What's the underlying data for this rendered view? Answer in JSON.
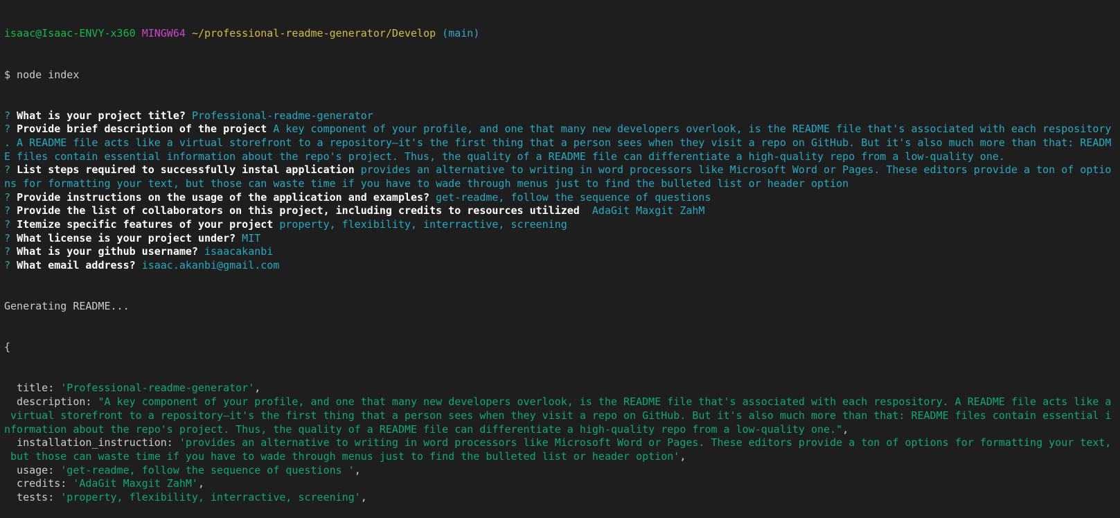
{
  "prompt": {
    "user": "isaac@Isaac-ENVY-x360",
    "shell": "MINGW64",
    "path": "~/professional-readme-generator/Develop",
    "branch": "(main)",
    "command": "$ node index"
  },
  "qa": [
    {
      "q": "What is your project title?",
      "a": "Professional-readme-generator",
      "wrap": []
    },
    {
      "q": "Provide brief description of the project",
      "a": "A key component of your profile, and one that many new developers overlook, is the README file that's associated with each respository",
      "wrap": [
        ". A README file acts like a virtual storefront to a repository—it's the first thing that a person sees when they visit a repo on GitHub. But it's also much more than that: READM",
        "E files contain essential information about the repo's project. Thus, the quality of a README file can differentiate a high-quality repo from a low-quality one."
      ]
    },
    {
      "q": "List steps required to successfully instal application",
      "a": "provides an alternative to writing in word processors like Microsoft Word or Pages. These editors provide a ton of optio",
      "wrap": [
        "ns for formatting your text, but those can waste time if you have to wade through menus just to find the bulleted list or header option"
      ]
    },
    {
      "q": "Provide instructions on the usage of the application and examples?",
      "a": "get-readme, follow the sequence of questions",
      "wrap": []
    },
    {
      "q": "Provide the list of collaborators on this project, including credits to resources utilized",
      "a": " AdaGit Maxgit ZahM",
      "wrap": []
    },
    {
      "q": "Itemize specific features of your project",
      "a": "property, flexibility, interractive, screening",
      "wrap": []
    },
    {
      "q": "What license is your project under?",
      "a": "MIT",
      "wrap": []
    },
    {
      "q": "What is your github username?",
      "a": "isaacakanbi",
      "wrap": []
    },
    {
      "q": "What email address?",
      "a": "isaac.akanbi@gmail.com",
      "wrap": []
    }
  ],
  "generating": "Generating README...",
  "brace_open": "{",
  "output": [
    {
      "key": "  title: ",
      "val": "'Professional-readme-generator'",
      "tail": ",",
      "wrap": []
    },
    {
      "key": "  description: ",
      "val": "\"A key component of your profile, and one that many new developers overlook, is the README file that's associated with each respository. A README file acts like a",
      "tail": "",
      "wrap": [
        " virtual storefront to a repository—it's the first thing that a person sees when they visit a repo on GitHub. But it's also much more than that: README files contain essential i",
        "nformation about the repo's project. Thus, the quality of a README file can differentiate a high-quality repo from a low-quality one.\""
      ],
      "wrap_tail": ","
    },
    {
      "key": "  installation_instruction: ",
      "val": "'provides an alternative to writing in word processors like Microsoft Word or Pages. These editors provide a ton of options for formatting your text,",
      "tail": "",
      "wrap": [
        " but those can waste time if you have to wade through menus just to find the bulleted list or header option'"
      ],
      "wrap_tail": ","
    },
    {
      "key": "  usage: ",
      "val": "'get-readme, follow the sequence of questions '",
      "tail": ",",
      "wrap": []
    },
    {
      "key": "  credits: ",
      "val": "'AdaGit Maxgit ZahM'",
      "tail": ",",
      "wrap": []
    },
    {
      "key": "  tests: ",
      "val": "'property, flexibility, interractive, screening'",
      "tail": ",",
      "wrap": []
    }
  ]
}
